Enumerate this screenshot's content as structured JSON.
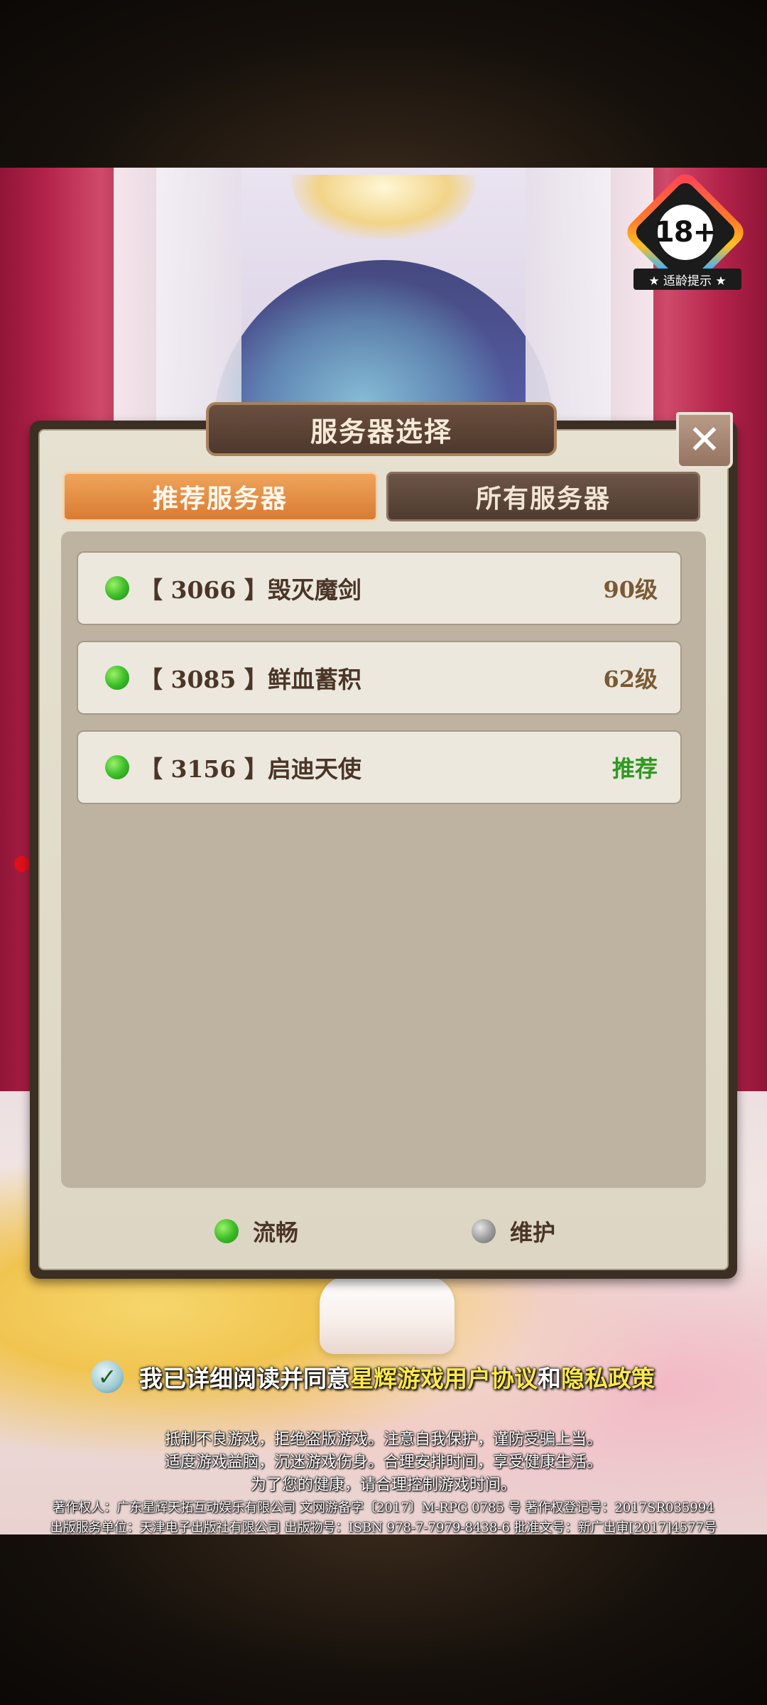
{
  "age_badge": {
    "rating": "18+",
    "label": "★ 适龄提示 ★"
  },
  "dialog": {
    "title": "服务器选择",
    "close_icon": "close-icon",
    "tabs": [
      {
        "label": "推荐服务器",
        "active": true
      },
      {
        "label": "所有服务器",
        "active": false
      }
    ],
    "servers": [
      {
        "name": "【 3066 】毁灭魔剑",
        "tag": "90级",
        "tag_color": "#7a5a34",
        "status": "green"
      },
      {
        "name": "【 3085 】鲜血蓄积",
        "tag": "62级",
        "tag_color": "#7a5a34",
        "status": "green"
      },
      {
        "name": "【 3156 】启迪天使",
        "tag": "推荐",
        "tag_color": "#2e9a1f",
        "status": "green"
      }
    ],
    "legend": {
      "smooth": "流畅",
      "maintenance": "维护"
    }
  },
  "agreement": {
    "prefix": "我已详细阅读并同意",
    "user_agreement": "星辉游戏用户协议",
    "and": "和",
    "privacy_policy": "隐私政策",
    "checked": true
  },
  "health_notice": [
    "抵制不良游戏，拒绝盗版游戏。注意自我保护，谨防受骗上当。",
    "适度游戏益脑，沉迷游戏伤身。合理安排时间，享受健康生活。",
    "为了您的健康，请合理控制游戏时间。"
  ],
  "legal_lines": [
    "著作权人：广东星辉天拓互动娱乐有限公司  文网游备字〔2017〕M-RPG 0785 号  著作权登记号：2017SR035994",
    "出版服务单位：天津电子出版社有限公司  出版物号：ISBN 978-7-7979-8438-6  批准文号：新广出审[2017]4577号"
  ],
  "colors": {
    "accent_orange": "#e58b3f",
    "status_green": "#3fbf2a",
    "highlight_yellow": "#ffe94a"
  }
}
